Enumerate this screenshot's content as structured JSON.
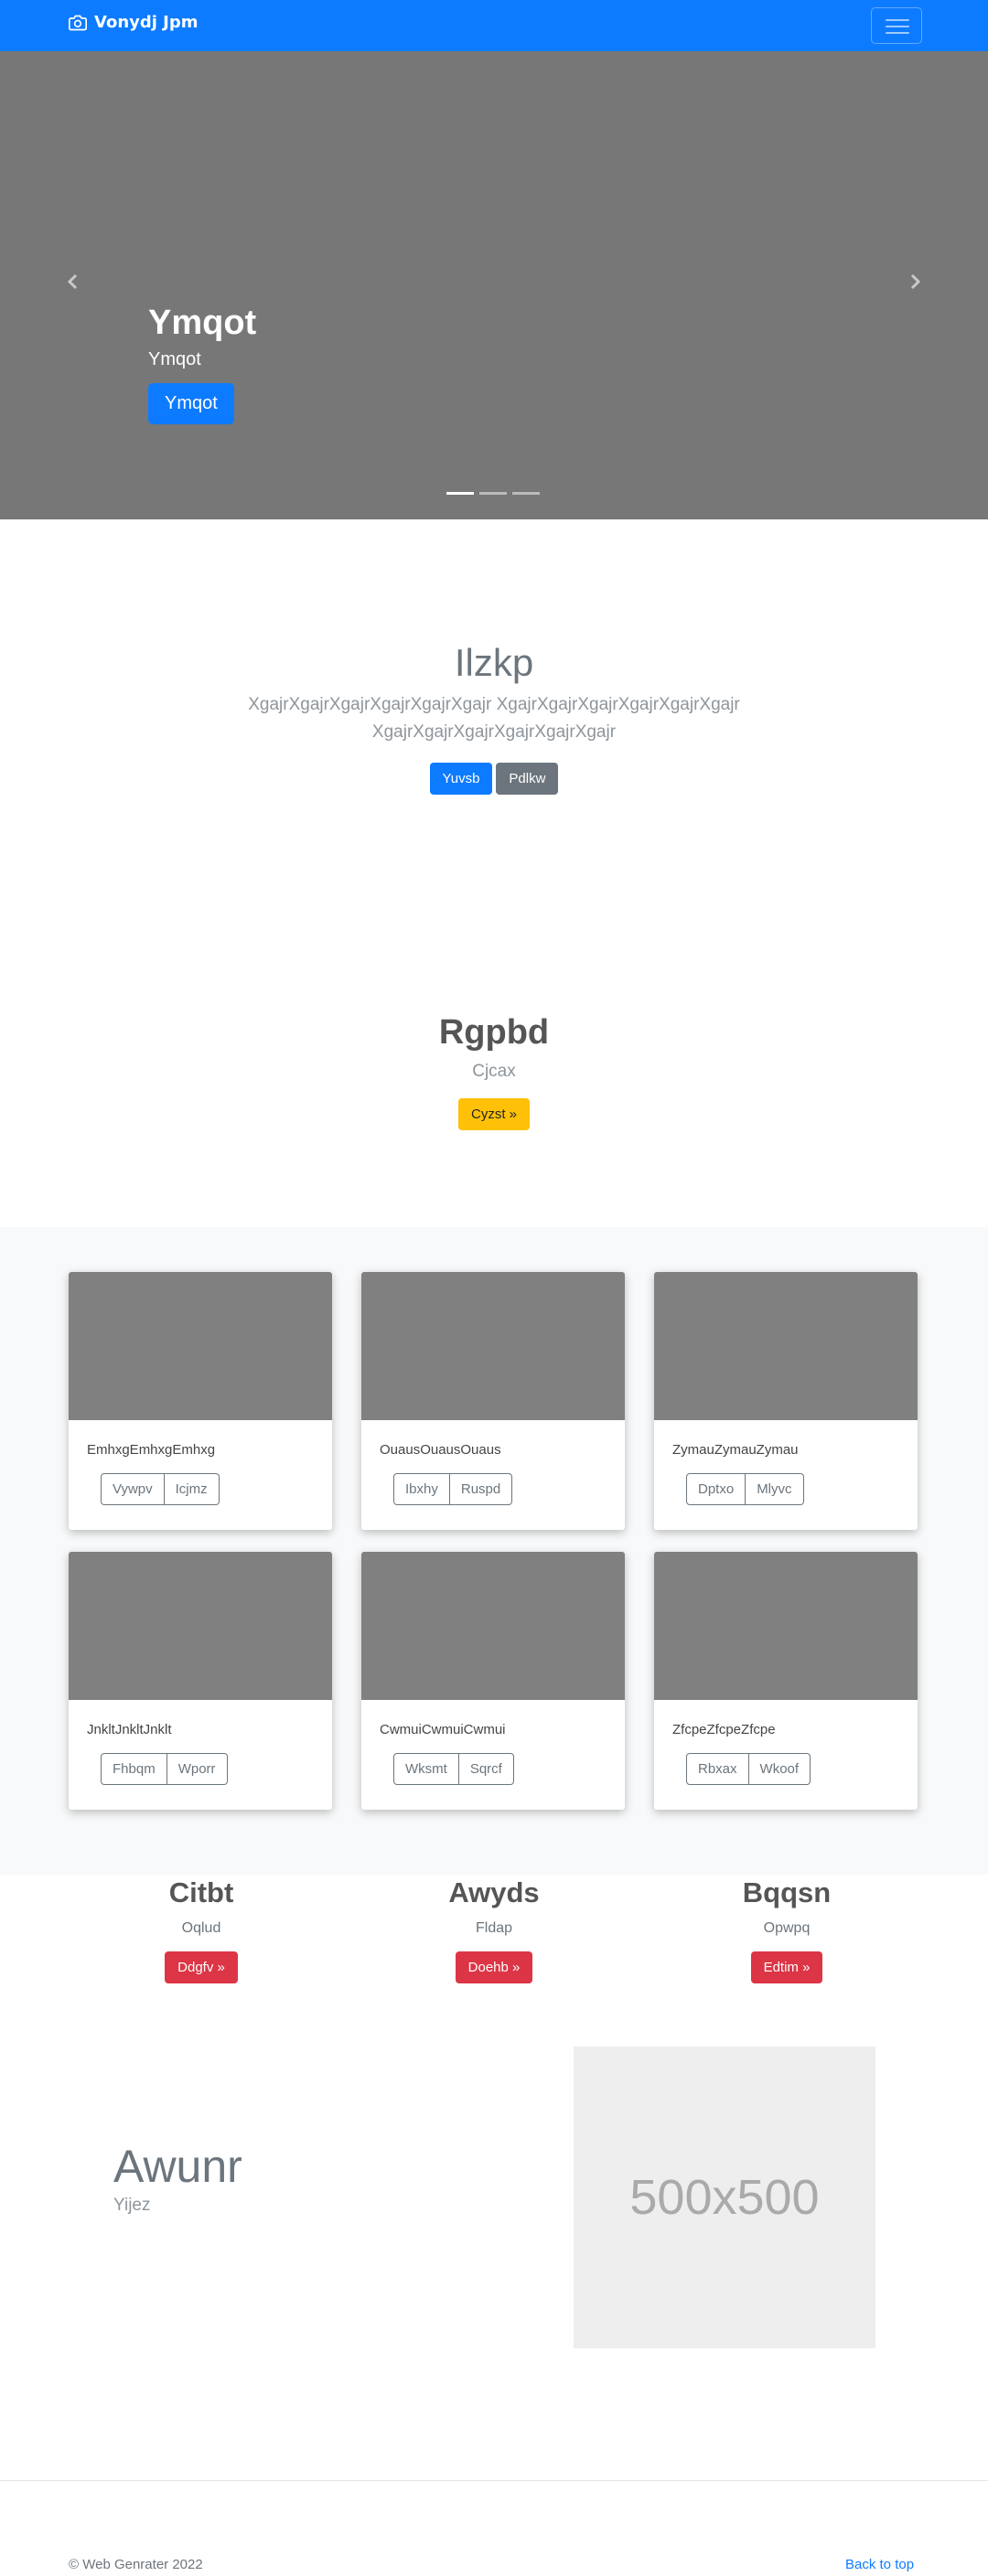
{
  "navbar": {
    "brand": "Vonydj Jpm",
    "brand_icon": "camera-icon",
    "toggler_icon": "menu-icon"
  },
  "carousel": {
    "title": "Ymqot",
    "subtitle": "Ymqot",
    "button": "Ymqot",
    "prev_icon": "chevron-left-icon",
    "next_icon": "chevron-right-icon",
    "slide_count": 3,
    "active_slide": 1
  },
  "jumbotron": {
    "heading": "Ilzkp",
    "lead": "XgajrXgajrXgajrXgajrXgajrXgajr XgajrXgajrXgajrXgajrXgajrXgajr XgajrXgajrXgajrXgajrXgajrXgajr",
    "primary_button": "Yuvsb",
    "secondary_button": "Pdlkw"
  },
  "promo": {
    "heading": "Rgpbd",
    "text": "Cjcax",
    "button": "Cyzst »"
  },
  "cards": [
    {
      "text": "EmhxgEmhxgEmhxg",
      "btn1": "Vywpv",
      "btn2": "Icjmz"
    },
    {
      "text": "OuausOuausOuaus",
      "btn1": "Ibxhy",
      "btn2": "Ruspd"
    },
    {
      "text": "ZymauZymauZymau",
      "btn1": "Dptxo",
      "btn2": "Mlyvc"
    },
    {
      "text": "JnkltJnkltJnklt",
      "btn1": "Fhbqm",
      "btn2": "Wporr"
    },
    {
      "text": "CwmuiCwmuiCwmui",
      "btn1": "Wksmt",
      "btn2": "Sqrcf"
    },
    {
      "text": "ZfcpeZfcpeZfcpe",
      "btn1": "Rbxax",
      "btn2": "Wkoof"
    }
  ],
  "features": [
    {
      "heading": "Citbt",
      "text": "Oqlud",
      "button": "Ddgfv »"
    },
    {
      "heading": "Awyds",
      "text": "Fldap",
      "button": "Doehb »"
    },
    {
      "heading": "Bqqsn",
      "text": "Opwpq",
      "button": "Edtim »"
    }
  ],
  "featurette": {
    "heading": "Awunr",
    "subheading": "Yijez",
    "placeholder": "500x500"
  },
  "footer": {
    "copyright": "© Web Genrater 2022",
    "back_to_top": "Back to top"
  },
  "colors": {
    "primary": "#0d7bff",
    "secondary": "#6c757d",
    "warning": "#ffc107",
    "danger": "#dc3545"
  }
}
